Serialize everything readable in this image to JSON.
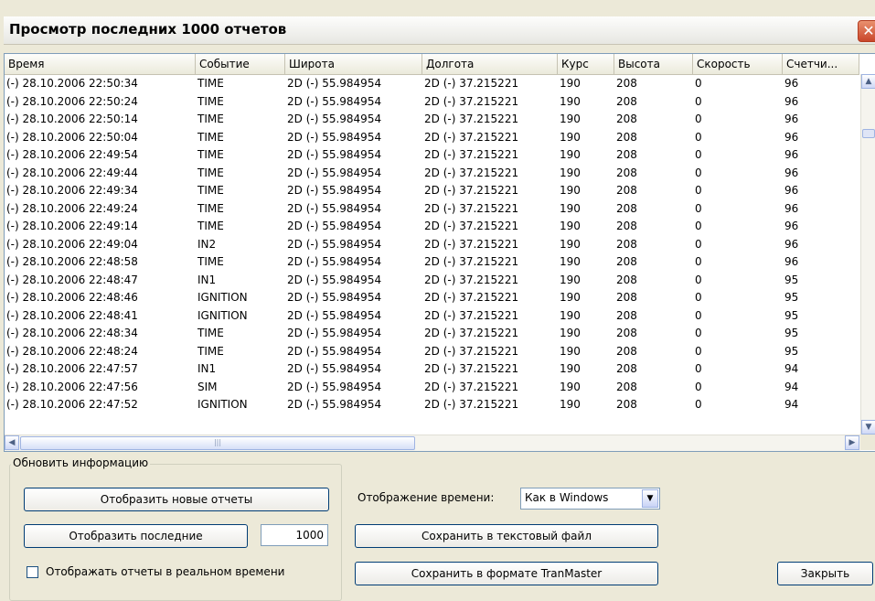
{
  "window": {
    "title": "Просмотр последних 1000 отчетов",
    "close_glyph": "✕"
  },
  "table": {
    "columns": [
      "Время",
      "Событие",
      "Широта",
      "Долгота",
      "Курс",
      "Высота",
      "Скорость",
      "Счетчи..."
    ],
    "rows": [
      [
        "(-) 28.10.2006 22:50:34",
        "TIME",
        "2D (-) 55.984954",
        "2D (-) 37.215221",
        "190",
        "208",
        "0",
        "96"
      ],
      [
        "(-) 28.10.2006 22:50:24",
        "TIME",
        "2D (-) 55.984954",
        "2D (-) 37.215221",
        "190",
        "208",
        "0",
        "96"
      ],
      [
        "(-) 28.10.2006 22:50:14",
        "TIME",
        "2D (-) 55.984954",
        "2D (-) 37.215221",
        "190",
        "208",
        "0",
        "96"
      ],
      [
        "(-) 28.10.2006 22:50:04",
        "TIME",
        "2D (-) 55.984954",
        "2D (-) 37.215221",
        "190",
        "208",
        "0",
        "96"
      ],
      [
        "(-) 28.10.2006 22:49:54",
        "TIME",
        "2D (-) 55.984954",
        "2D (-) 37.215221",
        "190",
        "208",
        "0",
        "96"
      ],
      [
        "(-) 28.10.2006 22:49:44",
        "TIME",
        "2D (-) 55.984954",
        "2D (-) 37.215221",
        "190",
        "208",
        "0",
        "96"
      ],
      [
        "(-) 28.10.2006 22:49:34",
        "TIME",
        "2D (-) 55.984954",
        "2D (-) 37.215221",
        "190",
        "208",
        "0",
        "96"
      ],
      [
        "(-) 28.10.2006 22:49:24",
        "TIME",
        "2D (-) 55.984954",
        "2D (-) 37.215221",
        "190",
        "208",
        "0",
        "96"
      ],
      [
        "(-) 28.10.2006 22:49:14",
        "TIME",
        "2D (-) 55.984954",
        "2D (-) 37.215221",
        "190",
        "208",
        "0",
        "96"
      ],
      [
        "(-) 28.10.2006 22:49:04",
        "IN2",
        "2D (-) 55.984954",
        "2D (-) 37.215221",
        "190",
        "208",
        "0",
        "96"
      ],
      [
        "(-) 28.10.2006 22:48:58",
        "TIME",
        "2D (-) 55.984954",
        "2D (-) 37.215221",
        "190",
        "208",
        "0",
        "96"
      ],
      [
        "(-) 28.10.2006 22:48:47",
        "IN1",
        "2D (-) 55.984954",
        "2D (-) 37.215221",
        "190",
        "208",
        "0",
        "95"
      ],
      [
        "(-) 28.10.2006 22:48:46",
        "IGNITION",
        "2D (-) 55.984954",
        "2D (-) 37.215221",
        "190",
        "208",
        "0",
        "95"
      ],
      [
        "(-) 28.10.2006 22:48:41",
        "IGNITION",
        "2D (-) 55.984954",
        "2D (-) 37.215221",
        "190",
        "208",
        "0",
        "95"
      ],
      [
        "(-) 28.10.2006 22:48:34",
        "TIME",
        "2D (-) 55.984954",
        "2D (-) 37.215221",
        "190",
        "208",
        "0",
        "95"
      ],
      [
        "(-) 28.10.2006 22:48:24",
        "TIME",
        "2D (-) 55.984954",
        "2D (-) 37.215221",
        "190",
        "208",
        "0",
        "95"
      ],
      [
        "(-) 28.10.2006 22:47:57",
        "IN1",
        "2D (-) 55.984954",
        "2D (-) 37.215221",
        "190",
        "208",
        "0",
        "94"
      ],
      [
        "(-) 28.10.2006 22:47:56",
        "SIM",
        "2D (-) 55.984954",
        "2D (-) 37.215221",
        "190",
        "208",
        "0",
        "94"
      ],
      [
        "(-) 28.10.2006 22:47:52",
        "IGNITION",
        "2D (-) 55.984954",
        "2D (-) 37.215221",
        "190",
        "208",
        "0",
        "94"
      ]
    ]
  },
  "refresh_group": {
    "legend": "Обновить информацию",
    "show_new_label": "Отобразить новые отчеты",
    "show_last_label": "Отобразить последние",
    "count_value": "1000",
    "realtime_label": "Отображать отчеты в реальном времени",
    "realtime_checked": false
  },
  "time_display": {
    "label": "Отображение времени:",
    "value": "Как в Windows"
  },
  "actions": {
    "save_text_label": "Сохранить в текстовый файл",
    "save_tranmaster_label": "Сохранить в формате TranMaster",
    "close_label": "Закрыть"
  },
  "icons": {
    "scroll_up": "up-arrow-icon",
    "scroll_down": "down-arrow-icon",
    "scroll_left": "left-arrow-icon",
    "scroll_right": "right-arrow-icon",
    "dropdown": "chevron-down-icon"
  }
}
